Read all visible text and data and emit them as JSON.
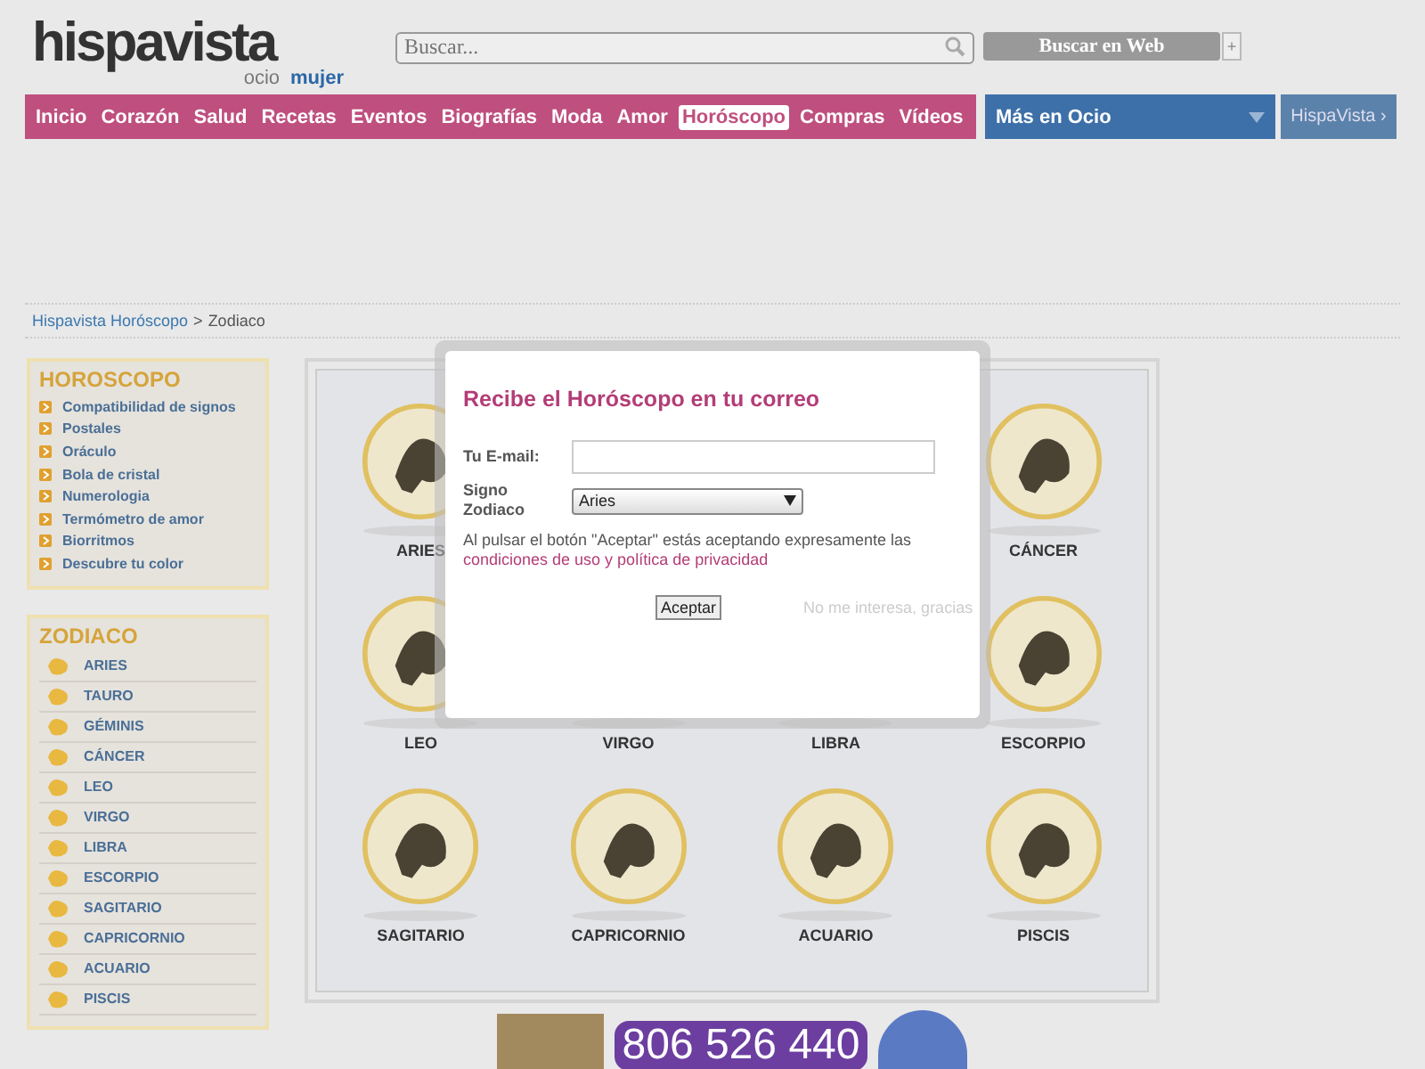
{
  "header": {
    "logo": {
      "brand": "hispavista",
      "section": "ocio",
      "subsection": "mujer"
    },
    "search": {
      "placeholder": "Buscar..."
    },
    "search_button": "Buscar en Web",
    "plus": "+"
  },
  "nav": {
    "items": [
      {
        "label": "Inicio",
        "selected": false
      },
      {
        "label": "Corazón",
        "selected": false
      },
      {
        "label": "Salud",
        "selected": false
      },
      {
        "label": "Recetas",
        "selected": false
      },
      {
        "label": "Eventos",
        "selected": false
      },
      {
        "label": "Biografías",
        "selected": false
      },
      {
        "label": "Moda",
        "selected": false
      },
      {
        "label": "Amor",
        "selected": false
      },
      {
        "label": "Horóscopo",
        "selected": true
      },
      {
        "label": "Compras",
        "selected": false
      },
      {
        "label": "Vídeos",
        "selected": false
      }
    ],
    "more": "Más en Ocio",
    "portal": "HispaVista ›"
  },
  "breadcrumb": {
    "link": "Hispavista Horóscopo",
    "separator": ">",
    "current": "Zodiaco"
  },
  "sidebar": {
    "horoscopo": {
      "title": "HOROSCOPO",
      "items": [
        "Compatibilidad de signos",
        "Postales",
        "Oráculo",
        "Bola de cristal",
        "Numerologia",
        "Termómetro de amor",
        "Biorritmos",
        "Descubre tu color"
      ]
    },
    "zodiaco": {
      "title": "ZODIACO",
      "items": [
        "ARIES",
        "TAURO",
        "GÉMINIS",
        "CÁNCER",
        "LEO",
        "VIRGO",
        "LIBRA",
        "ESCORPIO",
        "SAGITARIO",
        "CAPRICORNIO",
        "ACUARIO",
        "PISCIS"
      ]
    }
  },
  "signs": [
    {
      "kind": "shown",
      "name": "ARIES"
    },
    {
      "kind": "covered"
    },
    {
      "kind": "covered"
    },
    {
      "kind": "shown",
      "name": "CÁNCER"
    },
    {
      "kind": "shown",
      "name": "LEO"
    },
    {
      "kind": "shown",
      "name": "VIRGO"
    },
    {
      "kind": "shown",
      "name": "LIBRA"
    },
    {
      "kind": "shown",
      "name": "ESCORPIO"
    },
    {
      "kind": "shown",
      "name": "SAGITARIO"
    },
    {
      "kind": "shown",
      "name": "CAPRICORNIO"
    },
    {
      "kind": "shown",
      "name": "ACUARIO"
    },
    {
      "kind": "shown",
      "name": "PISCIS"
    }
  ],
  "banner": {
    "phone": "806 526 440"
  },
  "modal": {
    "title": "Recibe el Horóscopo en tu correo",
    "email_label": "Tu E-mail:",
    "sign_label": "Signo Zodiaco",
    "sign_value": "Aries",
    "notice": "Al pulsar el botón \"Aceptar\" estás aceptando expresamente las",
    "terms_link": "condiciones de uso y política de privacidad",
    "accept": "Aceptar",
    "decline": "No me interesa, gracias"
  }
}
